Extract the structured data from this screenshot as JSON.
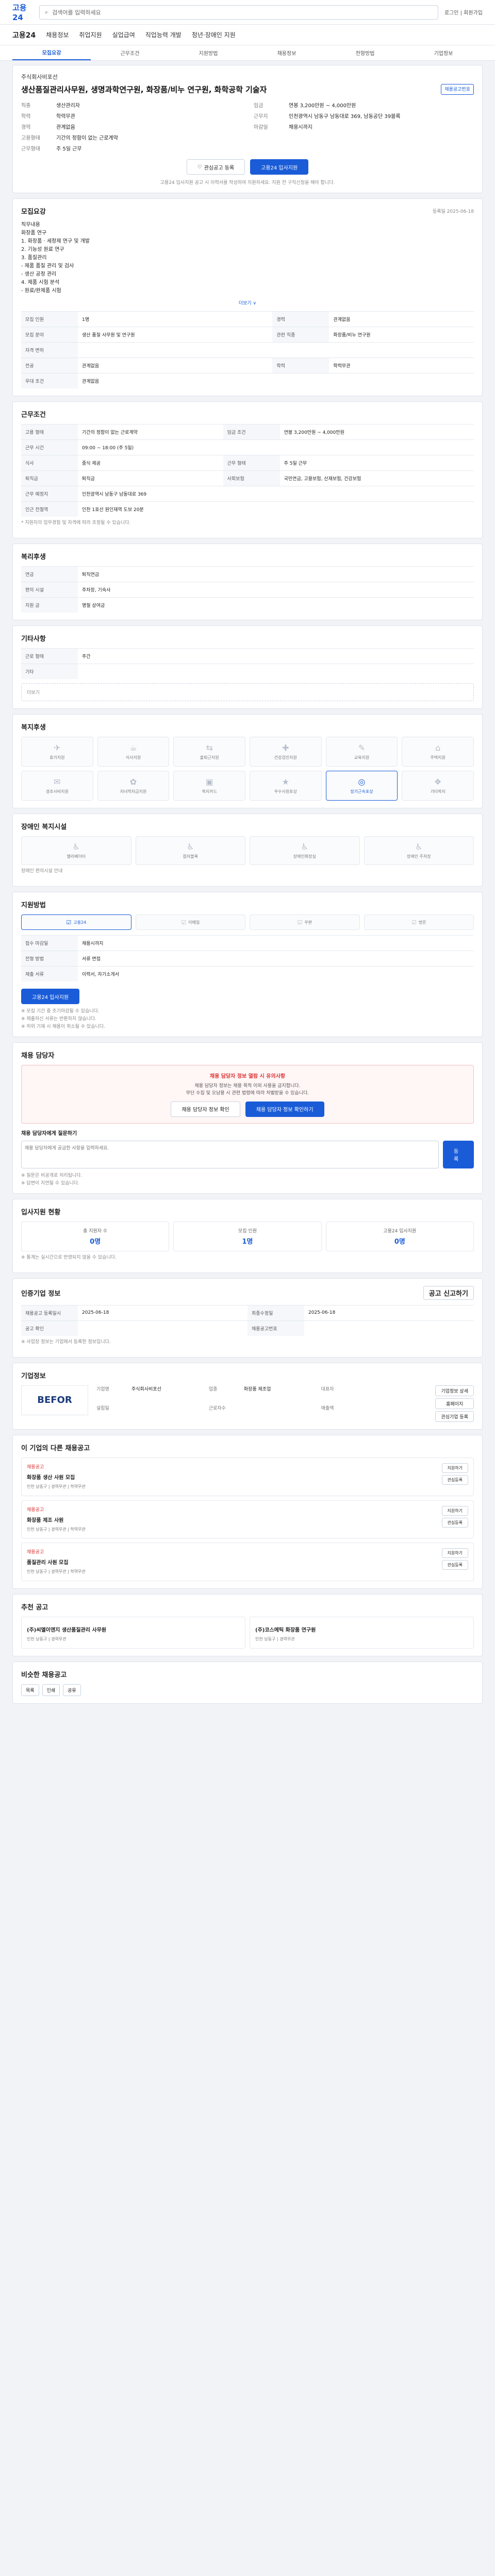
{
  "top": {
    "logo": "고용24",
    "search_placeholder": "검색어를 입력하세요",
    "user": "로그인 | 회원가입"
  },
  "nav": {
    "back": "고용24",
    "items": [
      "채용정보",
      "취업지원",
      "실업급여",
      "직업능력 개발",
      "청년·장애인 지원"
    ]
  },
  "tabs": [
    "모집요강",
    "근무조건",
    "지원방법",
    "채용정보",
    "전형방법",
    "기업정보"
  ],
  "header": {
    "company": "주식회사비포선",
    "title": "생산품질관리사무원, 생명과학연구원, 화장품/비누 연구원, 화학공학 기술자",
    "badge": "채용공고번호",
    "rows": [
      {
        "k": "직종",
        "v": "생산관리자"
      },
      {
        "k": "학력",
        "v": "학력무관"
      },
      {
        "k": "경력",
        "v": "관계없음"
      },
      {
        "k": "고용형태",
        "v": "기간의 정함이 없는 근로계약"
      },
      {
        "k": "근무형태",
        "v": "주 5일 근무"
      },
      {
        "k": "임금",
        "v": "연봉 3,200만원 ~ 4,000만원"
      },
      {
        "k": "근무지",
        "v": "인천광역시 남동구 남동대로 369, 남동공단 39블록"
      },
      {
        "k": "마감일",
        "v": "채용시까지"
      }
    ],
    "btn_scrap": "관심공고 등록",
    "btn_apply": "고용24 입사지원",
    "note": "고용24 입사지원 공고 시 이력서를 작성하여 지원하세요. 지원 전 구직신청을 해야 합니다."
  },
  "recruit": {
    "title": "모집요강",
    "date": "등록일 2025-06-18",
    "body": "직무내용\n화장품 연구\n1. 화장품 · 세정제 연구 및 개발\n2. 기능성 원료 연구\n3. 품질관리\n- 제품 품질 관리 및 검사\n- 생산 공정 관리\n4. 제품 시험 분석\n- 원료/완제품 시험",
    "more": "더보기 ∨",
    "rows": [
      {
        "k": "모집 인원",
        "v": "1명",
        "k2": "경력",
        "v2": "관계없음"
      },
      {
        "k": "모집 분야",
        "v": "생산 품질 사무원 및 연구원",
        "k2": "관련 직종",
        "v2": "화장품/비누 연구원"
      },
      {
        "k": "자격 면허",
        "v": "",
        "k2": "",
        "v2": ""
      },
      {
        "k": "전공",
        "v": "관계없음",
        "k2": "학력",
        "v2": "학력무관"
      },
      {
        "k": "우대 조건",
        "v": "관계없음",
        "k2": "",
        "v2": ""
      }
    ]
  },
  "work": {
    "title": "근무조건",
    "rows": [
      {
        "k": "고용 형태",
        "v": "기간의 정함이 없는 근로계약",
        "k2": "임금 조건",
        "v2": "연봉 3,200만원 ~ 4,000만원"
      },
      {
        "k": "근무 시간",
        "v": "09:00 ~ 18:00 (주 5일)",
        "k2": "",
        "v2": ""
      },
      {
        "k": "식사",
        "v": "중식 제공",
        "k2": "근무 형태",
        "v2": "주 5일 근무"
      },
      {
        "k": "퇴직금",
        "v": "퇴직금",
        "k2": "사회보험",
        "v2": "국민연금, 고용보험, 산재보험, 건강보험"
      },
      {
        "k": "근무 예정지",
        "v": "인천광역시 남동구 남동대로 369",
        "k2": "",
        "v2": ""
      },
      {
        "k": "인근 전철역",
        "v": "인천 1호선 원인재역 도보 20분",
        "k2": "",
        "v2": ""
      }
    ],
    "note": "* 지원자의 업무경험 및 자격에 따라 조정될 수 있습니다."
  },
  "benefit": {
    "title": "복리후생",
    "rows": [
      {
        "k": "연금",
        "v": "퇴직연금"
      },
      {
        "k": "편의 시설",
        "v": "주차장, 기숙사"
      },
      {
        "k": "지원 금",
        "v": "명절 상여금"
      }
    ]
  },
  "etc": {
    "title": "기타사항",
    "rows": [
      {
        "k": "근로 형태",
        "v": "주간"
      },
      {
        "k": "기타",
        "v": ""
      }
    ],
    "more": "더보기"
  },
  "welfare": {
    "title": "복지후생",
    "items": [
      "휴가지원",
      "식사지원",
      "출퇴근지원",
      "건강검진지원",
      "교육지원",
      "주택지원",
      "경조사비지원",
      "자녀학자금지원",
      "복지카드",
      "우수사원포상",
      "장기근속포상",
      "기타복지"
    ],
    "active_index": 10
  },
  "welfare2": {
    "title": "장애인 복지시설",
    "items": [
      "엘리베이터",
      "점자블록",
      "장애인화장실",
      "장애인 주차장"
    ],
    "note": "장애인 편의시설 안내"
  },
  "apply": {
    "title": "지원방법",
    "methods": [
      "고용24",
      "이메일",
      "우편",
      "방문"
    ],
    "rows": [
      {
        "k": "접수 마감일",
        "v": "채용시까지"
      },
      {
        "k": "전형 방법",
        "v": "서류 면접"
      },
      {
        "k": "제출 서류",
        "v": "이력서, 자기소개서"
      }
    ],
    "btn": "고용24 입사지원",
    "notes": [
      "※ 모집 기간 중 조기마감될 수 있습니다.",
      "※ 제출하신 서류는 반환하지 않습니다.",
      "※ 허위 기재 시 채용이 취소될 수 있습니다."
    ]
  },
  "qa": {
    "title": "채용 담당자",
    "alert": "채용 담당자 정보 열람 시 유의사항",
    "alert_sub": "채용 담당자 정보는 채용 목적 이외 사용을 금지합니다.\n무단 수집 및 오남용 시 관련 법령에 따라 처벌받을 수 있습니다.",
    "btn1": "채용 담당자 정보 확인",
    "btn2": "채용 담당자 정보 확인하기",
    "q_label": "채용 담당자에게 질문하기",
    "q_placeholder": "채용 담당자에게 궁금한 사항을 입력하세요.",
    "q_btn": "등록",
    "q_notes": [
      "※ 질문은 비공개로 처리됩니다.",
      "※ 답변이 지연될 수 있습니다."
    ]
  },
  "stats": {
    "title": "입사지원 현황",
    "items": [
      {
        "l": "총 지원자 수",
        "v": "0명"
      },
      {
        "l": "모집 인원",
        "v": "1명"
      },
      {
        "l": "고용24 입사지원",
        "v": "0명"
      }
    ],
    "note": "※ 통계는 실시간으로 반영되지 않을 수 있습니다."
  },
  "info": {
    "title": "인증기업 정보",
    "rows": [
      {
        "k": "채용공고 등록일시",
        "v": "2025-06-18",
        "k2": "최종수정일",
        "v2": "2025-06-18"
      },
      {
        "k": "공고 확인",
        "v": "",
        "k2": "채용공고번호",
        "v2": ""
      }
    ],
    "note": "※ 사업장 정보는 기업에서 등록한 정보입니다.",
    "btn": "공고 신고하기"
  },
  "company": {
    "title": "기업정보",
    "logo": "BEFOR",
    "rows": [
      {
        "k": "기업명",
        "v": "주식회사비포선"
      },
      {
        "k": "업종",
        "v": "화장품 제조업"
      },
      {
        "k": "대표자",
        "v": ""
      },
      {
        "k": "설립일",
        "v": ""
      },
      {
        "k": "근로자수",
        "v": ""
      },
      {
        "k": "매출액",
        "v": ""
      }
    ],
    "btns": [
      "기업정보 상세",
      "홈페이지",
      "관심기업 등록"
    ]
  },
  "others": {
    "title": "이 기업의 다른 채용공고",
    "items": [
      {
        "tag": "채용공고",
        "nm": "화장품 생산 사원 모집",
        "ln": "인천 남동구 | 경력무관 | 학력무관"
      },
      {
        "tag": "채용공고",
        "nm": "화장품 제조 사원",
        "ln": "인천 남동구 | 경력무관 | 학력무관"
      },
      {
        "tag": "채용공고",
        "nm": "품질관리 사원 모집",
        "ln": "인천 남동구 | 경력무관 | 학력무관"
      }
    ],
    "btns": [
      "지원하기",
      "관심등록"
    ]
  },
  "recommend": {
    "title": "추천 공고",
    "items": [
      {
        "nm": "(주)씨엘이엔지 생산품질관리 사무원",
        "ln": "인천 남동구 | 경력무관"
      },
      {
        "nm": "(주)코스메틱 화장품 연구원",
        "ln": "인천 남동구 | 경력무관"
      }
    ]
  },
  "footer": {
    "title": "비슷한 채용공고",
    "btns": [
      "목록",
      "인쇄",
      "공유"
    ]
  }
}
